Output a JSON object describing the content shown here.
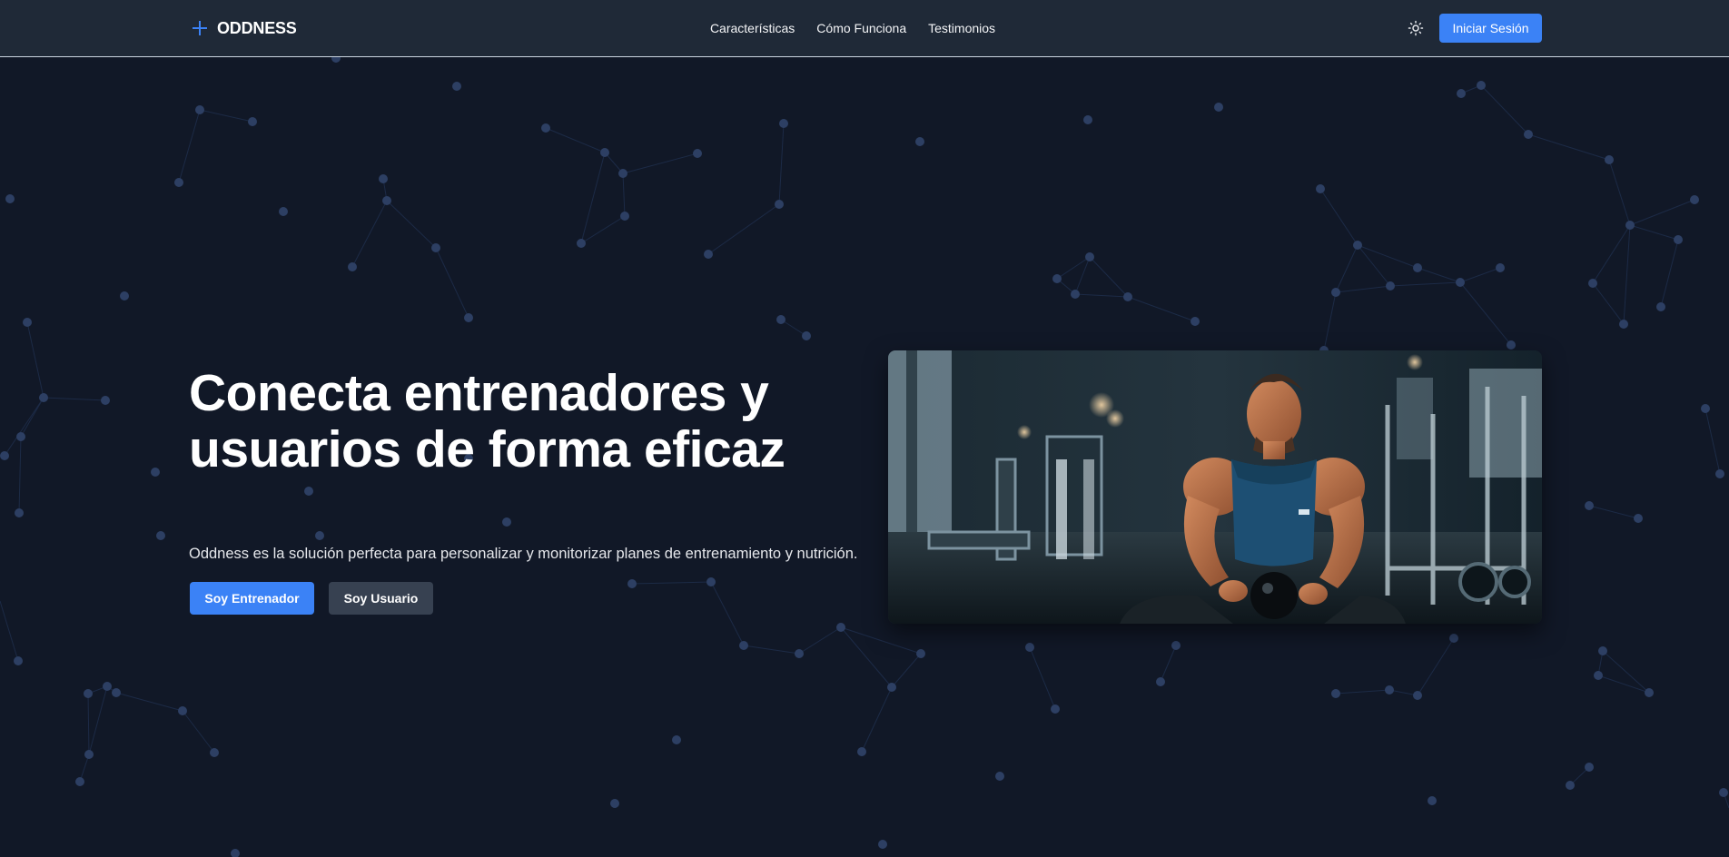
{
  "header": {
    "brand": "ODDNESS",
    "nav": [
      {
        "label": "Características"
      },
      {
        "label": "Cómo Funciona"
      },
      {
        "label": "Testimonios"
      }
    ],
    "login_label": "Iniciar Sesión"
  },
  "hero": {
    "title": "Conecta entrenadores y usuarios de forma eficaz",
    "subtitle": "Oddness es la solución perfecta para personalizar y monitorizar planes de entrenamiento y nutrición.",
    "primary_button": "Soy Entrenador",
    "secondary_button": "Soy Usuario"
  },
  "icons": {
    "logo": "plus-icon",
    "theme": "sun-icon"
  },
  "colors": {
    "accent": "#3b82f6",
    "background": "#111827",
    "header": "#1f2937",
    "secondary_button": "#374151",
    "network_node": "#2d3f63"
  }
}
